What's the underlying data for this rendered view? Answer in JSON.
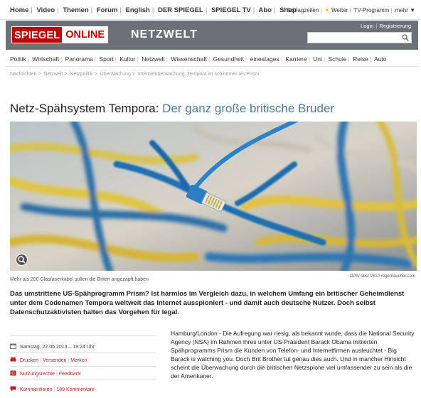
{
  "topnav": {
    "items": [
      "Home",
      "Video",
      "Themen",
      "Forum",
      "English",
      "DER SPIEGEL",
      "SPIEGEL TV",
      "Abo",
      "Shop"
    ],
    "utility": [
      "Schlagzeilen",
      "Wetter",
      "TV-Programm",
      "mehr ▼"
    ]
  },
  "header": {
    "logo_spiegel": "SPIEGEL",
    "logo_online": "ONLINE",
    "section": "NETZWELT",
    "login": "Login",
    "register": "Registrierung",
    "search_placeholder": ""
  },
  "catnav": {
    "items": [
      "Politik",
      "Wirtschaft",
      "Panorama",
      "Sport",
      "Kultur",
      "Netzwelt",
      "Wissenschaft",
      "Gesundheit",
      "einestages",
      "Karriere",
      "Uni",
      "Schule",
      "Reise",
      "Auto"
    ],
    "active": "Netzwelt"
  },
  "breadcrumb": [
    "Nachrichten",
    "Netzwelt",
    "Netzpolitik",
    "Überwachung",
    "Internetüberwachung: Tempora ist schlimmer als Prism"
  ],
  "article": {
    "kicker": "Netz-Spähsystem Tempora:",
    "title": "Der ganz große britische Bruder",
    "caption": "Mehr als 200 Glasfaserkabel sollen die Briten angezapft haben",
    "credit": "DPA/ obs/ VKU/ regentaucher.com",
    "lead": "Das umstrittene US-Spähprogramm Prism? Ist harmlos im Vergleich dazu, in welchem Umfang ein britischer Geheimdienst unter dem Codenamen Tempora weltweit das Internet ausspioniert - und damit auch deutsche Nutzer. Doch selbst Datenschutzaktivisten halten das Vorgehen für legal.",
    "date": "Samstag, 22.06.2013 – 19:24 Uhr",
    "print": "Drucken",
    "send": "Versenden",
    "bookmark": "Merken",
    "rights": "Nutzungsrechte",
    "feedback": "Feedback",
    "comments": "Kommentieren",
    "comments_count": "189 Kommentare",
    "body": "Hamburg/London - Die Aufregung war riesig, als bekannt wurde, dass die National Security Agency (NSA) im Rahmen ihres unter US-Präsident Barack Obama initiierten Spähprogramms Prism die Kunden von Telefon- und Internetfirmen ausleuchtet - Big Barack is watching you. Doch Brit Brother tut genau dies auch. Und in mancher Hinsicht scheint die Überwachung durch die britischen Netzspione viel umfassender zu sein als die der Amerikaner."
  },
  "colors": {
    "brand_red": "#c00000",
    "header_gray": "#6c7177",
    "title_blue": "#4f7c8e",
    "link_red": "#b22222"
  }
}
